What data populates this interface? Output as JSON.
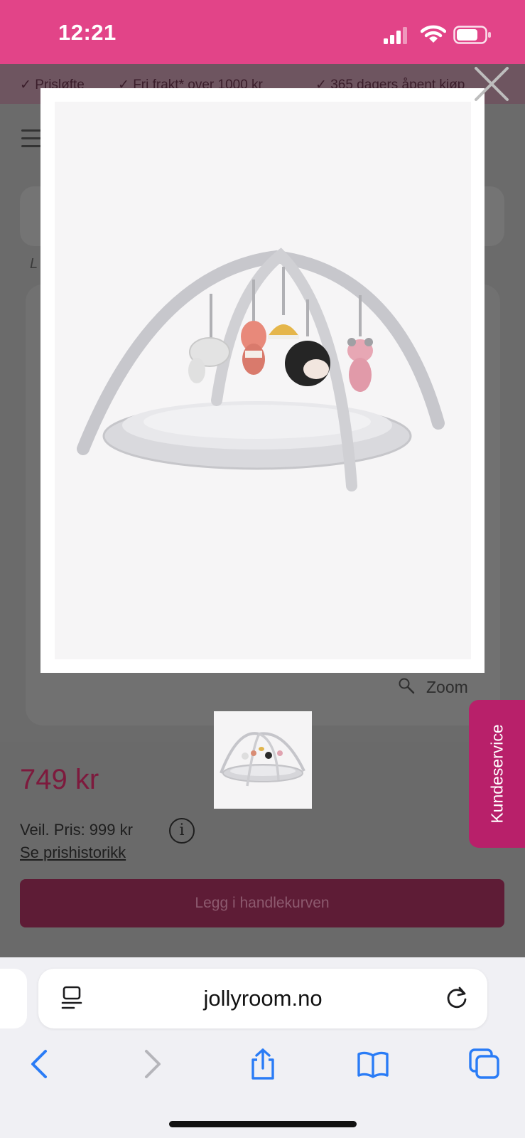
{
  "status_bar": {
    "time": "12:21",
    "background": "#e24488"
  },
  "usp_bar": {
    "items": [
      {
        "check": "✓",
        "label": "Prisløfte"
      },
      {
        "check": "✓",
        "label": "Fri frakt* over 1000 kr"
      },
      {
        "check": "✓",
        "label": "365 dagers åpent kjøp"
      }
    ]
  },
  "breadcrumb_hint": "L",
  "gallery": {
    "zoom_label": "Zoom",
    "modal_image": "baby-play-gym-with-hanging-toys",
    "close_icon": "close-icon"
  },
  "product": {
    "price": "749 kr",
    "recommended_price": "Veil. Pris: 999 kr",
    "info_icon": "i",
    "price_history_link": "Se prishistorikk",
    "add_to_cart_label": "Legg i handlekurven",
    "accent_color": "#b8206a"
  },
  "customer_service": {
    "label": "Kundeservice"
  },
  "browser": {
    "url": "jollyroom.no",
    "toolbar_icons": [
      "back-icon",
      "forward-icon",
      "share-icon",
      "bookmarks-icon",
      "tabs-icon"
    ]
  }
}
